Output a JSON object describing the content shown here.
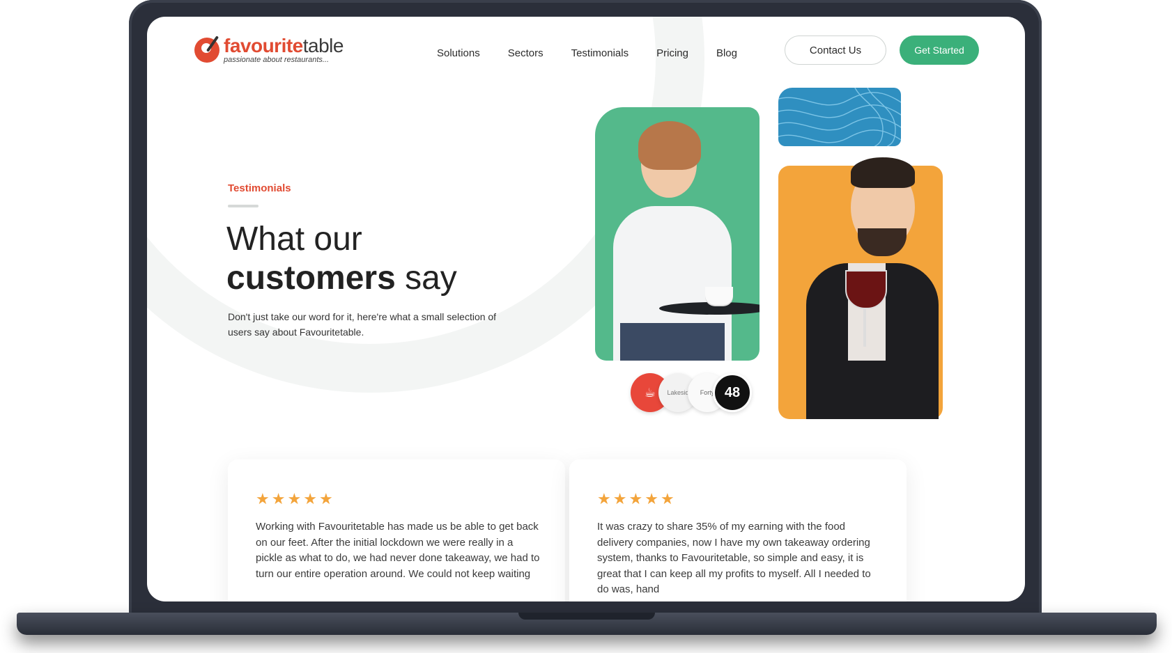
{
  "header": {
    "logo": {
      "brand_main": "favourite",
      "brand_second": "table",
      "tagline": "passionate about restaurants..."
    },
    "nav": [
      "Solutions",
      "Sectors",
      "Testimonials",
      "Pricing",
      "Blog"
    ],
    "contact_label": "Contact Us",
    "cta_label": "Get Started"
  },
  "hero": {
    "eyebrow": "Testimonials",
    "title_line1": "What our",
    "title_strong": "customers",
    "title_rest": " say",
    "description": "Don't just take our word for it, here're what a small selection of users say about Favouritetable.",
    "client_logos": [
      "coffee-logo",
      "Lakesid",
      "Forty",
      "48"
    ]
  },
  "testimonials": [
    {
      "rating": 5,
      "text": "Working with Favouritetable has made us be able to get back on our feet. After the initial lockdown we were really in a pickle as what to do, we had never done takeaway, we had to turn our entire operation around. We could not keep waiting"
    },
    {
      "rating": 5,
      "text": "It was crazy to share 35% of my earning with the food delivery companies, now I have my own takeaway ordering system, thanks to Favouritetable, so simple and easy, it is great that I can keep all my profits to myself. All I needed to do was, hand"
    }
  ],
  "colors": {
    "brand_red": "#e14b32",
    "brand_green": "#3bb07a",
    "accent_orange": "#f3a43b",
    "pattern_blue": "#2f8fc0"
  }
}
